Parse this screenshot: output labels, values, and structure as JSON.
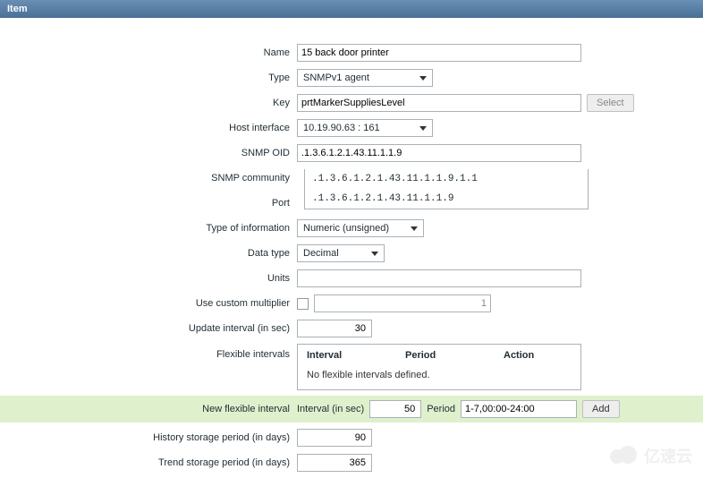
{
  "title": "Item",
  "labels": {
    "name": "Name",
    "type": "Type",
    "key": "Key",
    "host_interface": "Host interface",
    "snmp_oid": "SNMP OID",
    "snmp_community": "SNMP community",
    "port": "Port",
    "type_info": "Type of information",
    "data_type": "Data type",
    "units": "Units",
    "use_multiplier": "Use custom multiplier",
    "update_interval": "Update interval (in sec)",
    "flexible_intervals": "Flexible intervals",
    "new_flexible": "New flexible interval",
    "history_storage": "History storage period (in days)",
    "trend_storage": "Trend storage period (in days)"
  },
  "values": {
    "name": "15 back door printer",
    "type": "SNMPv1 agent",
    "key": "prtMarkerSuppliesLevel",
    "host_interface": "10.19.90.63 : 161",
    "snmp_oid": ".1.3.6.1.2.1.43.11.1.1.9",
    "type_info": "Numeric (unsigned)",
    "data_type": "Decimal",
    "units": "",
    "multiplier": "1",
    "update_interval": "30",
    "new_interval_sec": "50",
    "new_period": "1-7,00:00-24:00",
    "history_days": "90",
    "trend_days": "365"
  },
  "autocomplete": {
    "opt1": ".1.3.6.1.2.1.43.11.1.1.9.1.1",
    "opt2": ".1.3.6.1.2.1.43.11.1.1.9"
  },
  "buttons": {
    "select": "Select",
    "add": "Add"
  },
  "flex_table": {
    "h_interval": "Interval",
    "h_period": "Period",
    "h_action": "Action",
    "empty": "No flexible intervals defined."
  },
  "inline": {
    "interval_sec": "Interval (in sec)",
    "period": "Period"
  },
  "watermark": "亿速云"
}
